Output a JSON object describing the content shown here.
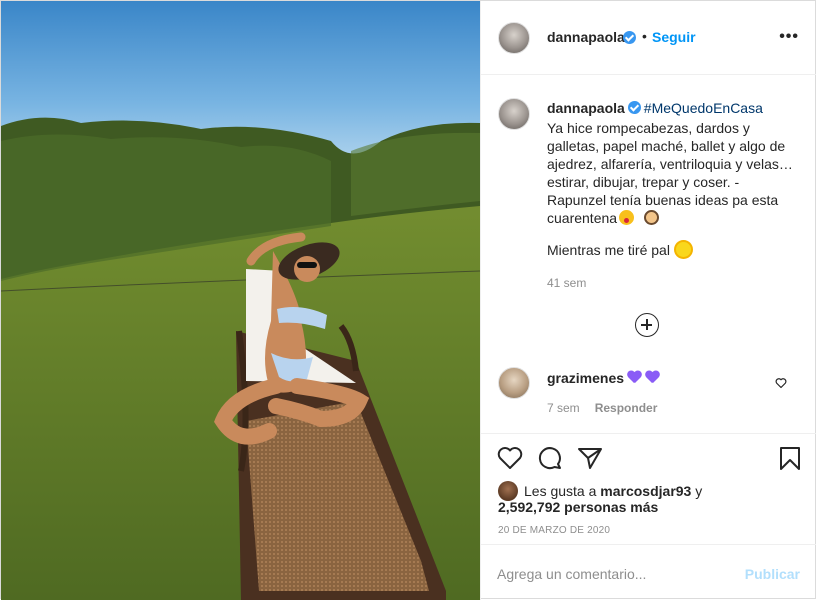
{
  "post": {
    "username": "dannapaola",
    "follow_label": "Seguir",
    "separator": "•",
    "more_label": "•••",
    "photo_alt": "Foto de dannapaola"
  },
  "caption": {
    "username": "dannapaola",
    "hashtag": "#MeQuedoEnCasa",
    "text": "Ya hice rompecabezas, dardos y galletas, papel maché, ballet y algo de ajedrez, alfarería, ventriloquia y velas… estirar, dibujar, trepar y coser. - Rapunzel tenía buenas ideas pa esta cuarentena",
    "line2": "Mientras me tiré pal",
    "time": "41 sem"
  },
  "comment": {
    "username": "grazimenes",
    "time": "7 sem",
    "reply_label": "Responder"
  },
  "likes": {
    "prefix": "Les gusta a",
    "user": "marcosdjar93",
    "suffix": "y",
    "others": "2,592,792 personas más"
  },
  "date": "20 DE MARZO DE 2020",
  "add_comment": {
    "placeholder": "Agrega un comentario...",
    "publish_label": "Publicar"
  },
  "colors": {
    "accent": "#0095f6",
    "verified": "#3897f0",
    "publish_disabled": "#b2dffc",
    "hashtag": "#00376b"
  },
  "icons": [
    "heart-icon",
    "comment-icon",
    "share-icon",
    "bookmark-icon",
    "plus-circle-icon",
    "more-icon",
    "verified-icon"
  ]
}
